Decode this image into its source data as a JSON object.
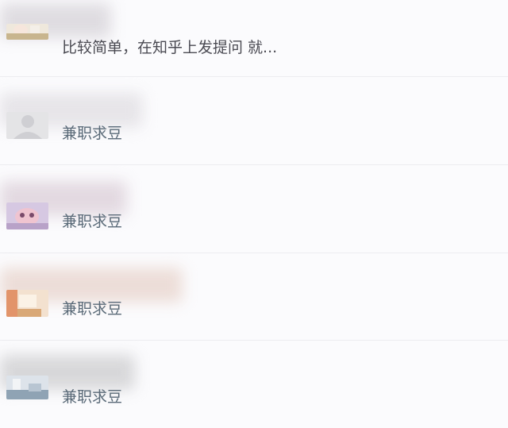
{
  "chat": {
    "items": [
      {
        "message": "比较简单，在知乎上发提问 就..."
      },
      {
        "message": "兼职求豆"
      },
      {
        "message": "兼职求豆"
      },
      {
        "message": "兼职求豆"
      },
      {
        "message": "兼职求豆"
      }
    ]
  },
  "colors": {
    "background": "#fbfbfd",
    "divider": "#ececf0",
    "message_text": "#4a4a52"
  }
}
